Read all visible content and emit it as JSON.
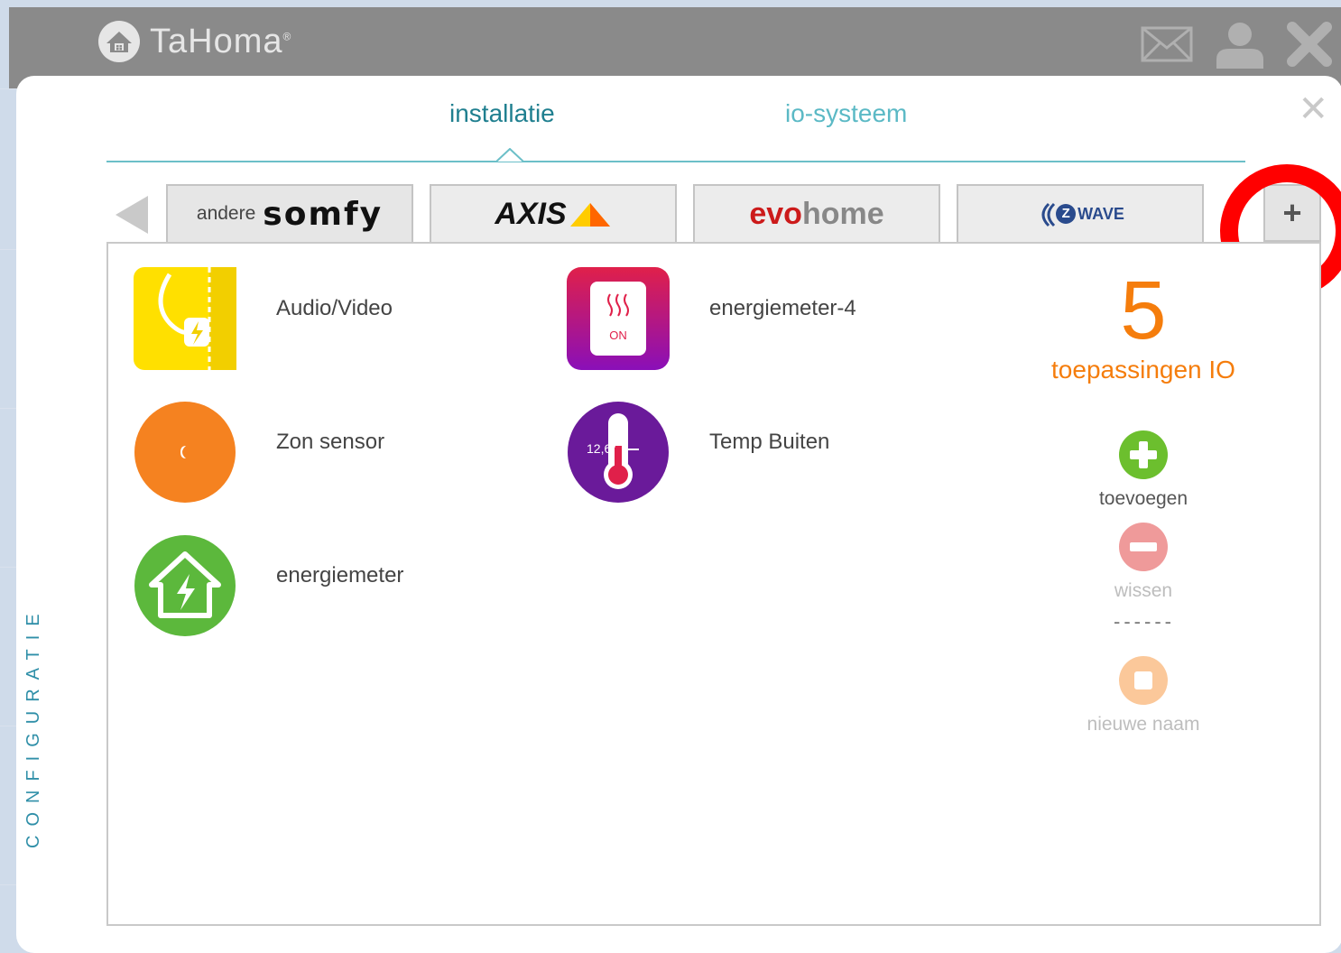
{
  "app": {
    "title": "TaHoma",
    "trademark": "®"
  },
  "topbar": {
    "icons": [
      "mail-icon",
      "user-icon",
      "close-icon"
    ]
  },
  "tabs": [
    {
      "label": "installatie",
      "active": true
    },
    {
      "label": "io-systeem",
      "active": false
    }
  ],
  "brands": {
    "somfy_prefix": "andere",
    "somfy": "somfy",
    "axis": "AXIS",
    "evo": "evo",
    "home": "home",
    "zwave": "WAVE",
    "zwave_z": "Z",
    "add": "+"
  },
  "devices": [
    {
      "label": "Audio/Video",
      "icon": "plug-icon"
    },
    {
      "label": "energiemeter-4",
      "icon": "heater-on-icon",
      "icon_text": "ON"
    },
    {
      "label": "Zon sensor",
      "icon": "sun-sensor-icon"
    },
    {
      "label": "Temp Buiten",
      "icon": "thermometer-icon",
      "icon_text": "12,6°"
    },
    {
      "label": "energiemeter",
      "icon": "house-energy-icon"
    }
  ],
  "stats": {
    "count": "5",
    "label": "toepassingen IO"
  },
  "actions": {
    "add": "toevoegen",
    "delete": "wissen",
    "divider": "------",
    "rename": "nieuwe naam"
  },
  "side_label": "CONFIGURATIE",
  "colors": {
    "accent": "#1f7f8f",
    "orange": "#f57d0c",
    "green": "#6cbf2e",
    "red_highlight": "#ff0000"
  }
}
